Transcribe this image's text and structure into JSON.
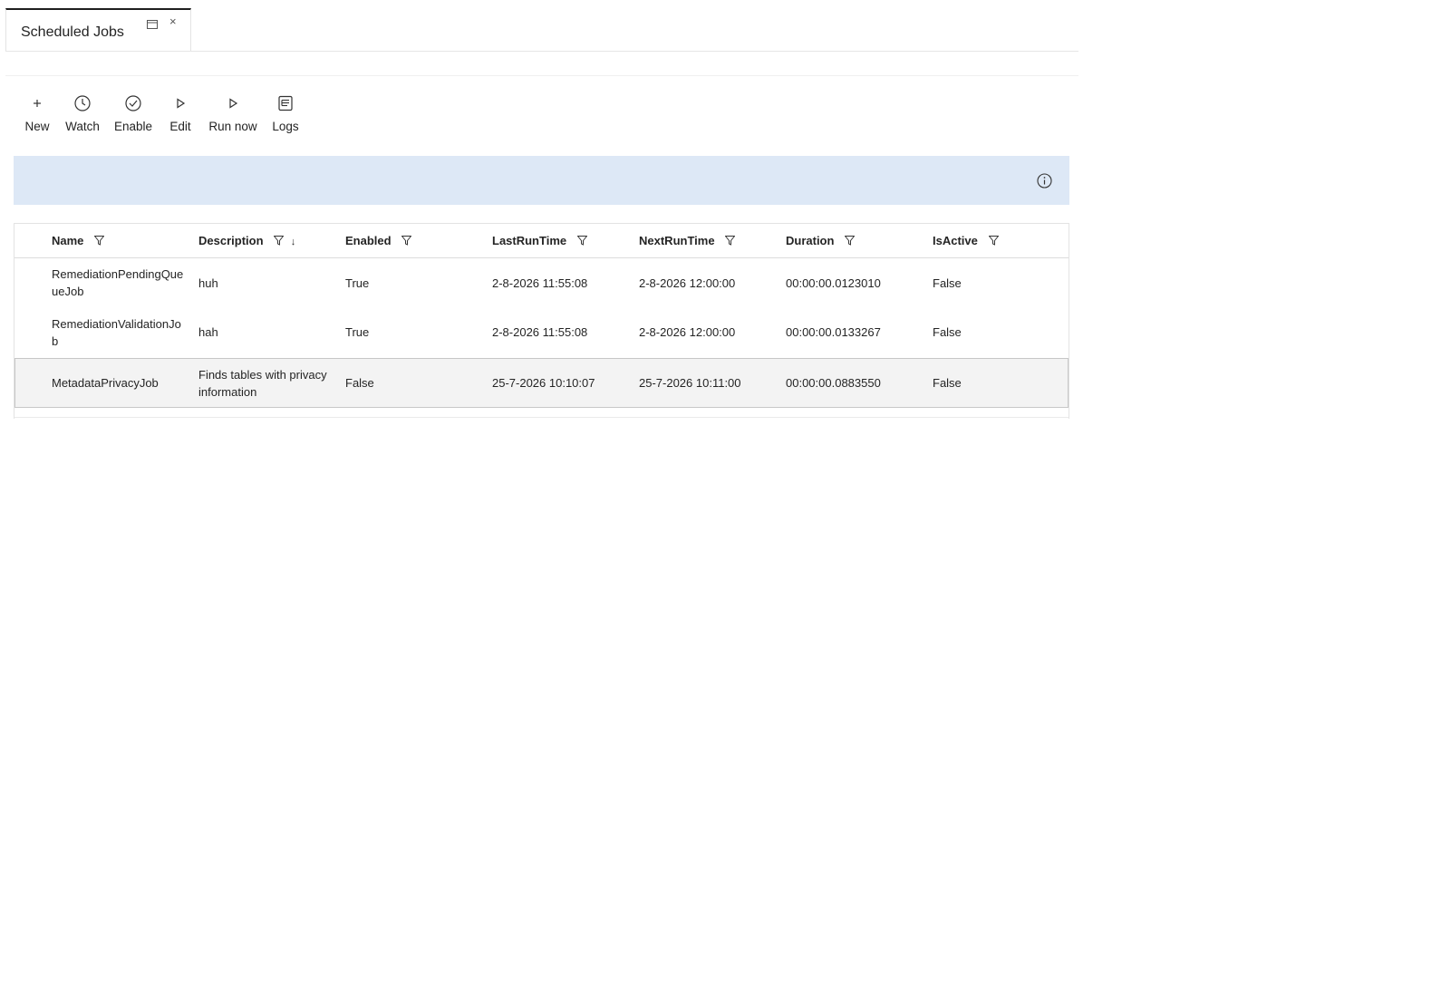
{
  "tab": {
    "title": "Scheduled Jobs",
    "restore_icon": "restore-window-icon",
    "close_glyph": "×"
  },
  "toolbar": {
    "buttons": [
      {
        "label": "New",
        "icon": "plus-icon"
      },
      {
        "label": "Watch",
        "icon": "clock-icon"
      },
      {
        "label": "Enable",
        "icon": "check-circle-icon"
      },
      {
        "label": "Edit",
        "icon": "play-icon"
      },
      {
        "label": "Run now",
        "icon": "play-icon"
      },
      {
        "label": "Logs",
        "icon": "log-document-icon"
      }
    ]
  },
  "banner": {
    "icon": "info-icon",
    "color": "#dde8f6"
  },
  "grid": {
    "columns": [
      {
        "label": "Name",
        "filter": true,
        "sort": ""
      },
      {
        "label": "Description",
        "filter": true,
        "sort": "↓"
      },
      {
        "label": "Enabled",
        "filter": true,
        "sort": ""
      },
      {
        "label": "LastRunTime",
        "filter": true,
        "sort": ""
      },
      {
        "label": "NextRunTime",
        "filter": true,
        "sort": ""
      },
      {
        "label": "Duration",
        "filter": true,
        "sort": ""
      },
      {
        "label": "IsActive",
        "filter": true,
        "sort": ""
      }
    ],
    "rows": [
      {
        "name": "RemediationPendingQue\nueJob",
        "description": "huh",
        "enabled": "True",
        "last_run": "2-8-2026 11:55:08",
        "next_run": "2-8-2026 12:00:00",
        "duration": "00:00:00.0123010",
        "is_active": "False",
        "selected": false
      },
      {
        "name": "RemediationValidationJo\nb",
        "description": "hah",
        "enabled": "True",
        "last_run": "2-8-2026 11:55:08",
        "next_run": "2-8-2026 12:00:00",
        "duration": "00:00:00.0133267",
        "is_active": "False",
        "selected": false
      },
      {
        "name": "MetadataPrivacyJob",
        "description": "Finds tables with privacy\ninformation",
        "enabled": "False",
        "last_run": "25-7-2026 10:10:07",
        "next_run": "25-7-2026 10:11:00",
        "duration": "00:00:00.0883550",
        "is_active": "False",
        "selected": true
      }
    ]
  }
}
